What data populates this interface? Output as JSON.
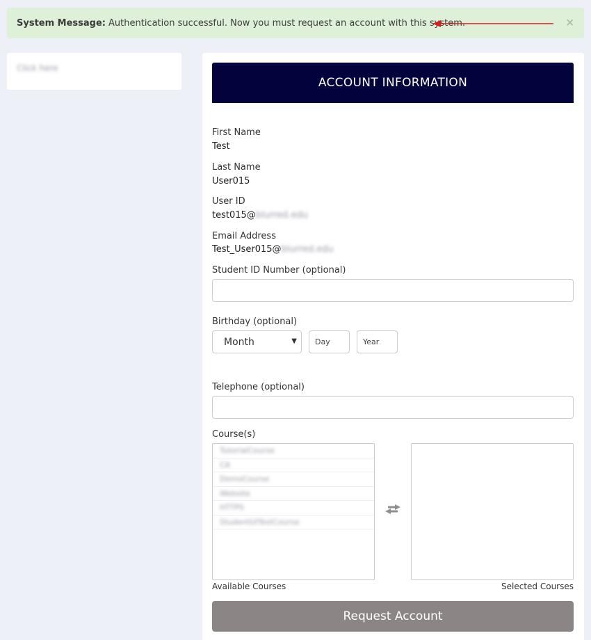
{
  "alert": {
    "prefix": "System Message:",
    "message": "Authentication successful. Now you must request an account with this system.",
    "close": "×"
  },
  "sidebar": {
    "link": "Click here"
  },
  "form": {
    "header": "ACCOUNT INFORMATION",
    "first_name": {
      "label": "First Name",
      "value": "Test"
    },
    "last_name": {
      "label": "Last Name",
      "value": "User015"
    },
    "user_id": {
      "label": "User ID",
      "value": "test015@",
      "redacted": "blurred.edu"
    },
    "email": {
      "label": "Email Address",
      "value": "Test_User015@",
      "redacted": "blurred.edu"
    },
    "student_id": {
      "label": "Student ID Number (optional)",
      "value": ""
    },
    "birthday": {
      "label": "Birthday (optional)",
      "month": "Month",
      "day_placeholder": "Day",
      "year_placeholder": "Year"
    },
    "telephone": {
      "label": "Telephone (optional)",
      "value": ""
    },
    "courses": {
      "label": "Course(s)",
      "available": [
        "TutorialCourse",
        "CA",
        "DemoCourse",
        "Website",
        "HTTPS",
        "StudentUITestCourse"
      ],
      "available_caption": "Available Courses",
      "selected_caption": "Selected Courses"
    },
    "submit": "Request Account"
  },
  "colors": {
    "alert_bg": "#dff0d8",
    "banner_bg": "#02023c",
    "submit_bg": "#8b8585",
    "annotation_arrow": "#d42020"
  }
}
